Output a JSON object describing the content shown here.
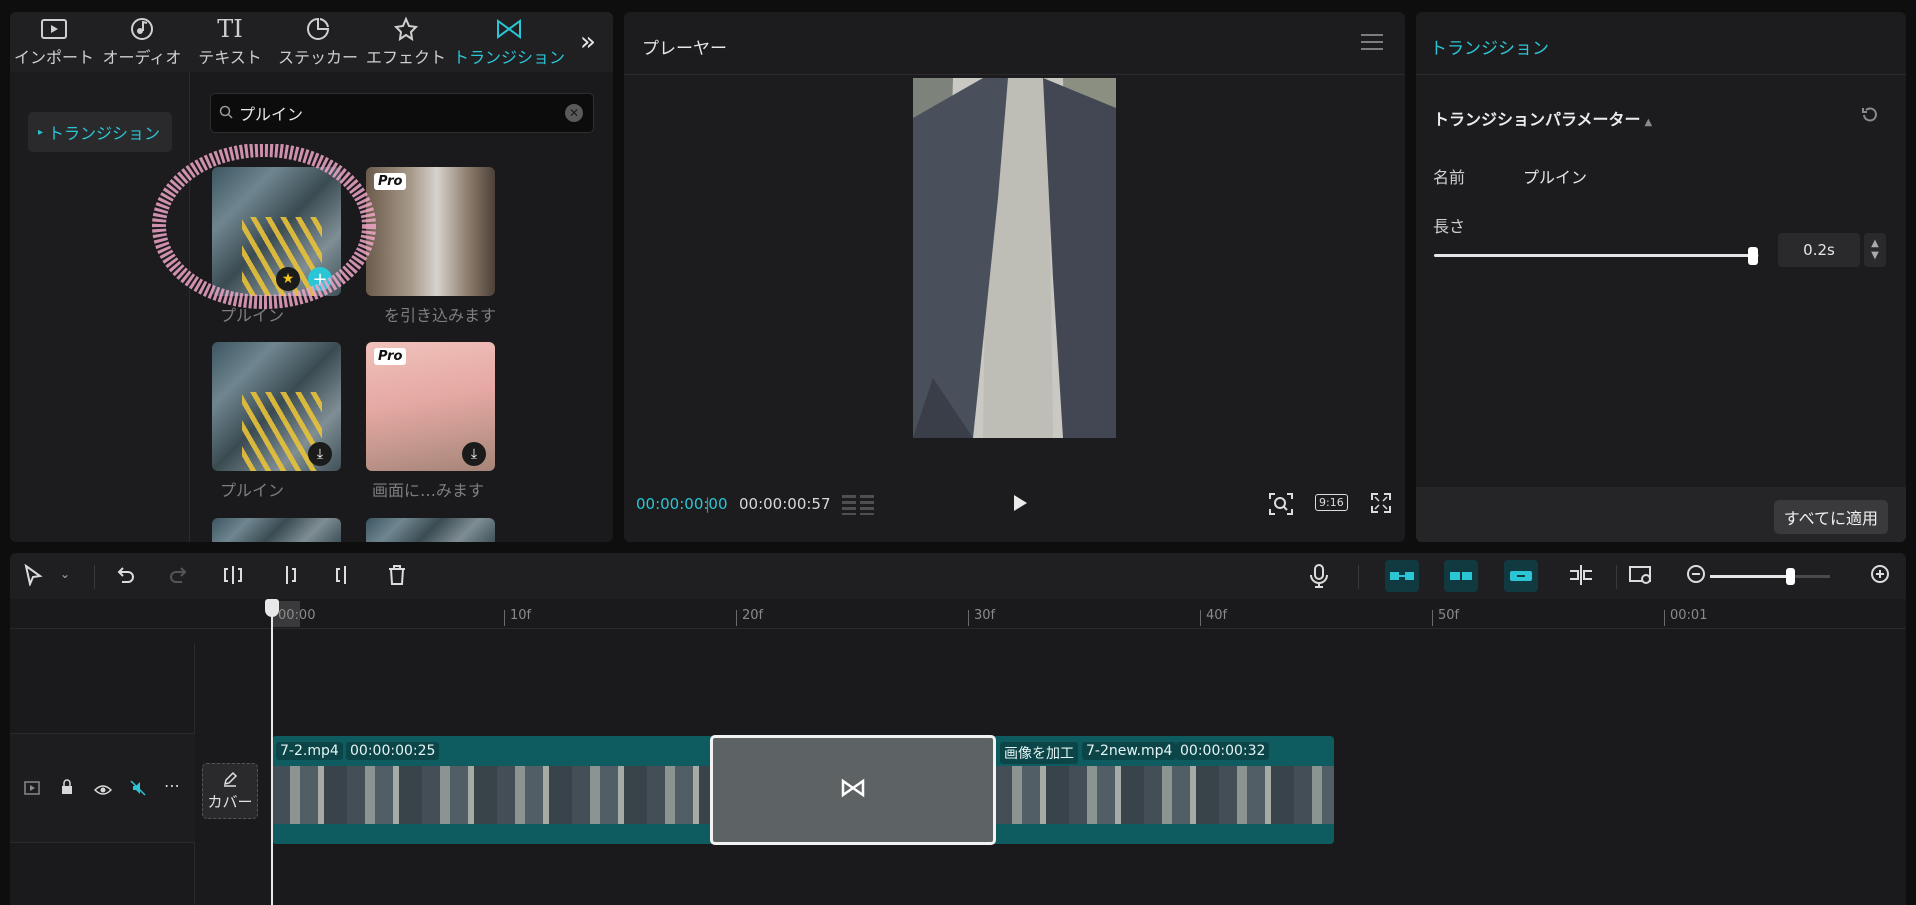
{
  "media_tabs": [
    {
      "label": "インポート",
      "icon": "import-icon"
    },
    {
      "label": "オーディオ",
      "icon": "audio-icon"
    },
    {
      "label": "テキスト",
      "icon": "text-icon"
    },
    {
      "label": "ステッカー",
      "icon": "sticker-icon"
    },
    {
      "label": "エフェクト",
      "icon": "effect-icon"
    },
    {
      "label": "トランジション",
      "icon": "transition-icon",
      "active": true
    }
  ],
  "category": {
    "label": "トランジション"
  },
  "search": {
    "value": "プルイン"
  },
  "thumbnails": [
    {
      "label": "プルイン",
      "pro": false,
      "badge": "add"
    },
    {
      "label": "を引き込みます",
      "pro": true,
      "pro_label": "Pro"
    },
    {
      "label": "プルイン",
      "pro": false,
      "badge": "download"
    },
    {
      "label": "画面に…みます",
      "pro": true,
      "pro_label": "Pro",
      "badge": "download"
    }
  ],
  "player": {
    "title": "プレーヤー",
    "current_time": "00:00:00:00",
    "total_time": "00:00:00:57",
    "aspect_label": "9:16"
  },
  "inspector": {
    "tab": "トランジション",
    "section_title": "トランジションパラメーター",
    "name_label": "名前",
    "name_value": "プルイン",
    "length_label": "長さ",
    "length_value": "0.2s",
    "length_fraction": 0.98,
    "apply_all": "すべてに適用"
  },
  "timeline": {
    "ruler": [
      "00:00",
      "10f",
      "20f",
      "30f",
      "40f",
      "50f",
      "00:01"
    ],
    "cover_label": "カバー",
    "zoom_fraction": 0.67,
    "clip1": {
      "name": "7-2.mp4",
      "duration": "00:00:00:25"
    },
    "clip2": {
      "edit_label": "画像を加工",
      "name": "7-2new.mp4",
      "duration": "00:00:00:32"
    }
  },
  "colors": {
    "accent": "#2bc6d6",
    "clip": "#0f5c60"
  }
}
